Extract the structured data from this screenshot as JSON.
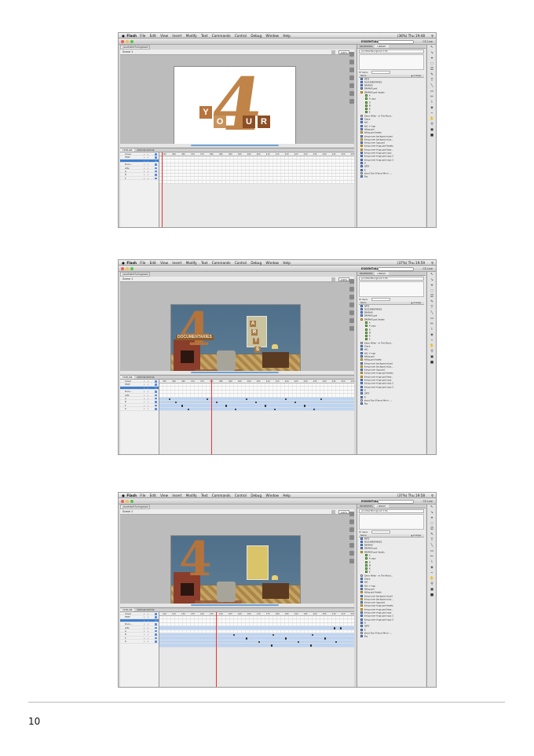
{
  "page_number": "10",
  "menubar": {
    "app": "Flash",
    "items": [
      "File",
      "Edit",
      "View",
      "Insert",
      "Modify",
      "Text",
      "Commands",
      "Control",
      "Debug",
      "Window",
      "Help"
    ]
  },
  "shots": [
    {
      "clock": "Thu 19:48",
      "battery": "(38%)"
    },
    {
      "clock": "Thu 19:59",
      "battery": "(37%)"
    },
    {
      "clock": "Thu 19:58",
      "battery": "(37%)"
    }
  ],
  "workspace": {
    "essentials": "ESSENTIALS ▾",
    "cslive": "CS Live"
  },
  "document": {
    "tab": "yourhdertfuringroom 1.fla",
    "scene": "Scene 1",
    "zoom": "100%"
  },
  "timeline": {
    "tabs": [
      "TIMELINE",
      "MOTION EDITOR"
    ],
    "layers": [
      "Cover",
      "TEXT",
      "",
      "Docu...",
      "Arts",
      "",
      "A",
      "R",
      "T",
      "S"
    ],
    "ruler1": "355 360 365 370 375 380 385 390 395 400 405 410 415 420 425 430 435 440 445 450 455",
    "ruler2": "355 360 365 370 375 380 385 390 395 400 405 410 415 420 425 430 435 440 445 450 455",
    "ruler3": "120 125 130 135 140 145 150 155 160 165 170 175 180 185 190 195 200 205 210 215 220 225 230"
  },
  "library": {
    "tabs": [
      "PROPERTIES",
      "LIBRARY"
    ],
    "file": "yourhdertfuringroom 1.fla",
    "count": "87 items",
    "col_name": "Name",
    "col_linkage": "▲ Linkage",
    "items": [
      "ARTS",
      "DOCUMENTARIES",
      "DRAMAS",
      "DRAMAS.psd",
      "DRAMAS.psd Assets",
      "A",
      "A copy",
      "D",
      "M",
      "R",
      "S",
      "Glenn Miller - In The Mood...",
      "Grace",
      "hit1",
      "hit1 + logo",
      "hitlog.psd",
      "hitlog.psd Assets",
      "living room background.psd",
      "living room background.ps...",
      "living room logo.psd",
      "living room+logo.psd Assets",
      "living room+logo.psd Asse...",
      "living room+logo.psd copy",
      "living room+logo.psd copy 2",
      "living room+logo.psd copy 3",
      "O",
      "QRTY",
      "R",
      "shout Don't Fence Me In -...",
      "Sky"
    ]
  },
  "tools": [
    "↖",
    "↘",
    "⌖",
    "◌",
    "⎚",
    "✎",
    "T",
    "╲",
    "▭",
    "✏",
    "⌇",
    "◈",
    "⌁",
    "✋",
    "⚲",
    "▣",
    "■"
  ],
  "stage1": {
    "big": "4",
    "letters": [
      "Y",
      "O",
      "U",
      "R"
    ]
  },
  "stage2": {
    "docu": "DOCUMENTARIES",
    "arts": [
      "A",
      "R",
      "T",
      "S"
    ],
    "big": "4"
  },
  "stage3": {
    "big": "4"
  }
}
